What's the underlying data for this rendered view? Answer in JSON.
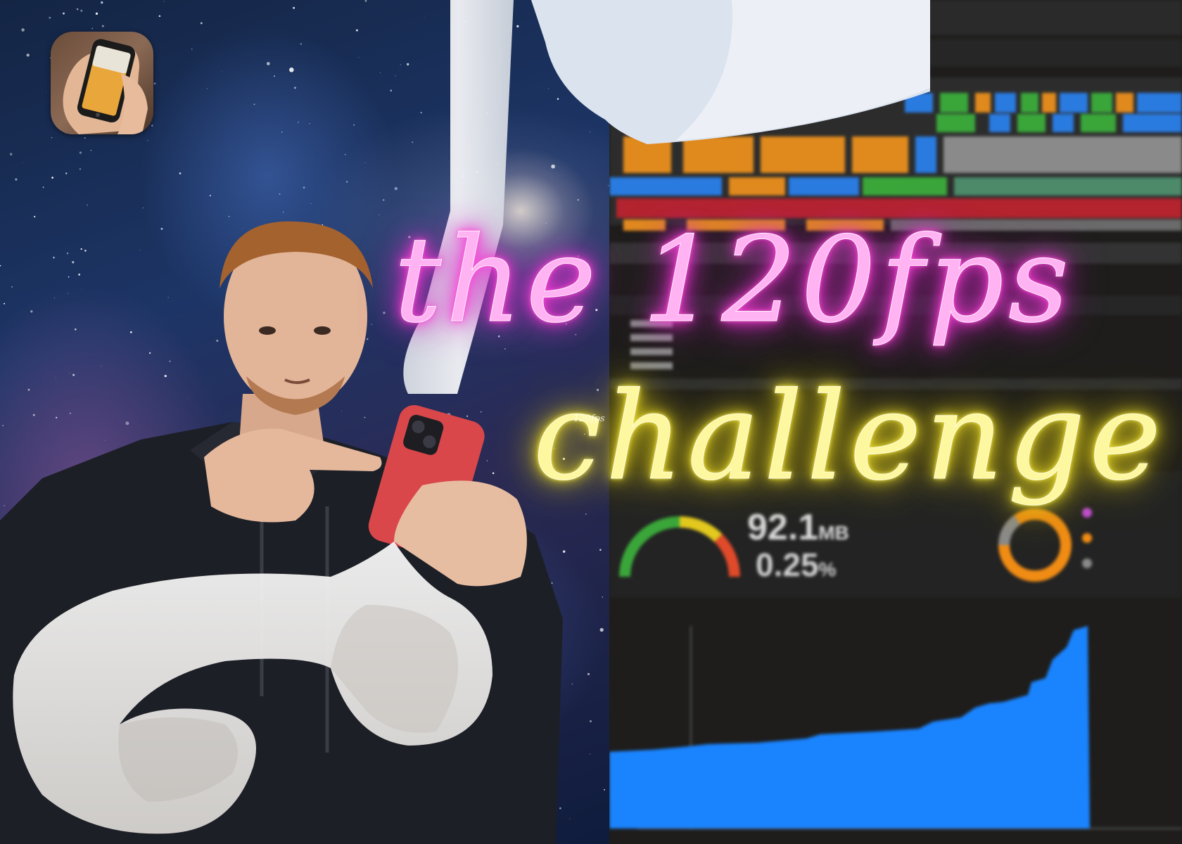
{
  "title": {
    "line1": "the 120fps",
    "line2": "challenge",
    "small_tag": "120fps"
  },
  "profiler": {
    "memory_value": "92.1",
    "memory_unit": "MB",
    "cpu_value": "0.25",
    "cpu_unit": "%"
  },
  "colors": {
    "neon_pink": "#ff3fd6",
    "neon_yellow": "#f2e32a",
    "profiler_bg": "#1e1d1b",
    "graph_blue": "#1a84ff"
  },
  "icons": {
    "app_icon": "phone-in-hand-app-icon"
  }
}
